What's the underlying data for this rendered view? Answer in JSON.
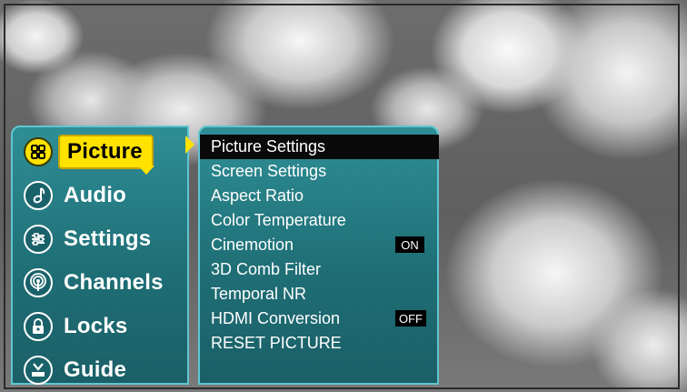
{
  "categories": [
    {
      "label": "Picture",
      "icon": "picture-menu-icon"
    },
    {
      "label": "Audio",
      "icon": "audio-note-icon"
    },
    {
      "label": "Settings",
      "icon": "settings-sliders-icon"
    },
    {
      "label": "Channels",
      "icon": "antenna-broadcast-icon"
    },
    {
      "label": "Locks",
      "icon": "lock-icon"
    },
    {
      "label": "Guide",
      "icon": "guide-icon"
    }
  ],
  "selected_category": "Picture",
  "submenu": [
    {
      "label": "Picture Settings",
      "value": ""
    },
    {
      "label": "Screen Settings",
      "value": ""
    },
    {
      "label": "Aspect Ratio",
      "value": ""
    },
    {
      "label": "Color Temperature",
      "value": ""
    },
    {
      "label": "Cinemotion",
      "value": "ON"
    },
    {
      "label": "3D Comb Filter",
      "value": ""
    },
    {
      "label": "Temporal NR",
      "value": ""
    },
    {
      "label": "HDMI Conversion",
      "value": "OFF"
    },
    {
      "label": "RESET PICTURE",
      "value": ""
    }
  ],
  "selected_submenu": "Picture Settings",
  "colors": {
    "panel": "#1f6f76",
    "panel_border": "#5fc6d0",
    "highlight": "#ffe200",
    "selection_bar": "#0a0a0a"
  }
}
